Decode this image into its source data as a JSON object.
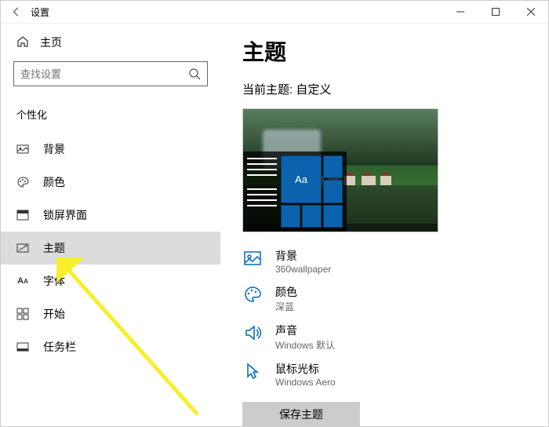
{
  "window": {
    "title": "设置"
  },
  "sidebar": {
    "home_label": "主页",
    "search_placeholder": "查找设置",
    "section_label": "个性化",
    "items": [
      {
        "label": "背景"
      },
      {
        "label": "颜色"
      },
      {
        "label": "锁屏界面"
      },
      {
        "label": "主题"
      },
      {
        "label": "字体"
      },
      {
        "label": "开始"
      },
      {
        "label": "任务栏"
      }
    ]
  },
  "main": {
    "title": "主题",
    "current_theme_label": "当前主题: 自定义",
    "preview_tile_text": "Aa",
    "props": [
      {
        "title": "背景",
        "value": "360wallpaper"
      },
      {
        "title": "颜色",
        "value": "深蓝"
      },
      {
        "title": "声音",
        "value": "Windows 默认"
      },
      {
        "title": "鼠标光标",
        "value": "Windows Aero"
      }
    ],
    "save_btn": "保存主题"
  }
}
